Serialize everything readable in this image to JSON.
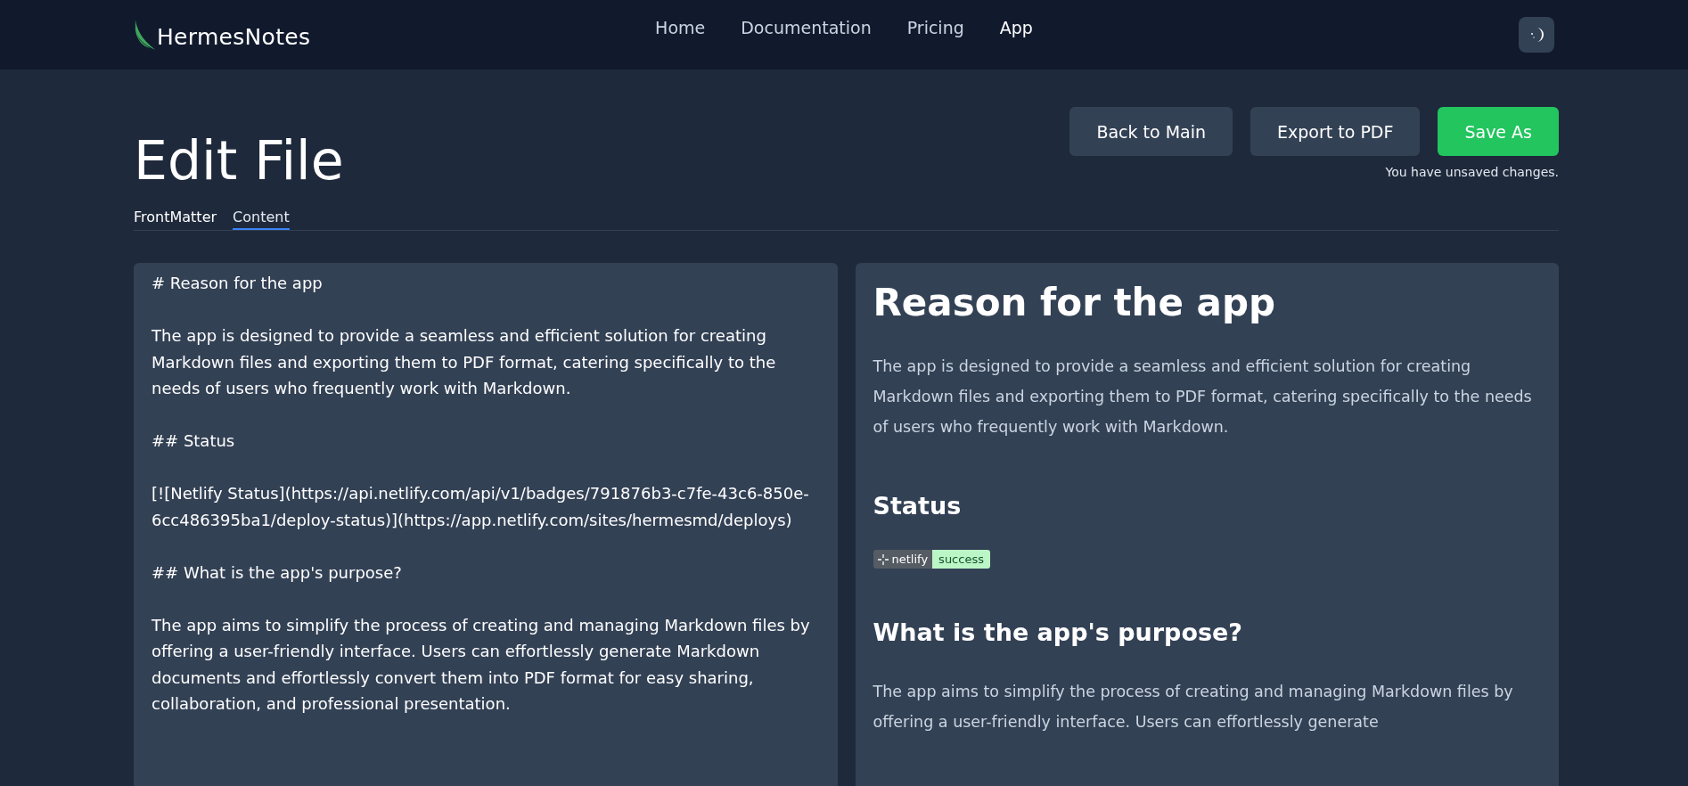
{
  "header": {
    "logo": "HermesNotes",
    "nav": [
      {
        "label": "Home",
        "selected": false
      },
      {
        "label": "Documentation",
        "selected": false
      },
      {
        "label": "Pricing",
        "selected": false
      },
      {
        "label": "App",
        "selected": true
      }
    ]
  },
  "page": {
    "title": "Edit File",
    "buttons": [
      {
        "label": "Back to Main",
        "kind": "secondary"
      },
      {
        "label": "Export to PDF",
        "kind": "secondary"
      },
      {
        "label": "Save As",
        "kind": "primary"
      }
    ],
    "notice": "You have unsaved changes."
  },
  "tabs": [
    {
      "label": "FrontMatter",
      "selected": false
    },
    {
      "label": "Content",
      "selected": true
    }
  ],
  "editor": {
    "value": "# Reason for the app\n\nThe app is designed to provide a seamless and efficient solution for creating Markdown files and exporting them to PDF format, catering specifically to the needs of users who frequently work with Markdown.\n\n## Status\n\n[![Netlify Status](https://api.netlify.com/api/v1/badges/791876b3-c7fe-43c6-850e-6cc486395ba1/deploy-status)](https://app.netlify.com/sites/hermesmd/deploys)\n\n## What is the app's purpose?\n\nThe app aims to simplify the process of creating and managing Markdown files by offering a user-friendly interface. Users can effortlessly generate Markdown documents and effortlessly convert them into PDF format for easy sharing, collaboration, and professional presentation."
  },
  "preview": [
    {
      "kind": "h1",
      "text": "Reason for the app"
    },
    {
      "kind": "p",
      "text": "The app is designed to provide a seamless and efficient solution for creating Markdown files and exporting them to PDF format, catering specifically to the needs of users who frequently work with Markdown."
    },
    {
      "kind": "h2",
      "text": "Status"
    },
    {
      "kind": "badge",
      "label": "netlify",
      "status": "success"
    },
    {
      "kind": "h2",
      "text": "What is the app's purpose?"
    },
    {
      "kind": "p",
      "text": "The app aims to simplify the process of creating and managing Markdown files by offering a user-friendly interface. Users can effortlessly generate"
    }
  ]
}
